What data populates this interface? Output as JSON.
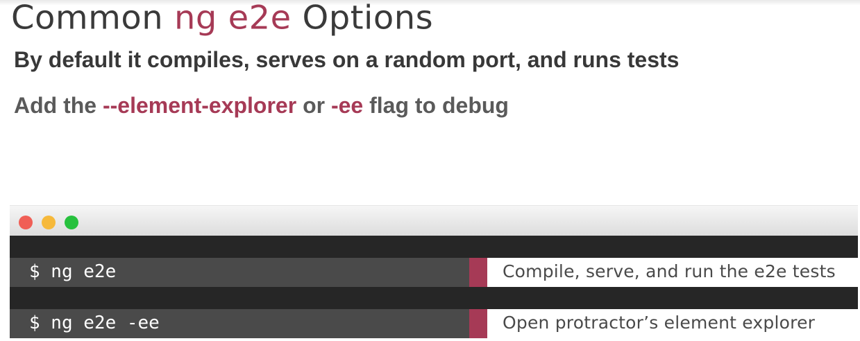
{
  "slide": {
    "title_pre": "Common ",
    "title_accent": "ng e2e",
    "title_post": " Options",
    "line1": "By default it compiles, serves on a random port, and runs tests",
    "line2_pre": "Add the ",
    "line2_flag1": "--element-explorer",
    "line2_mid": " or ",
    "line2_flag2": "-ee",
    "line2_post": " flag to debug"
  },
  "terminal": {
    "rows": [
      {
        "command": "$ ng e2e",
        "description": "Compile, serve, and run the e2e tests"
      },
      {
        "command": "$ ng e2e -ee",
        "description": "Open protractor’s element explorer"
      }
    ]
  },
  "colors": {
    "accent": "#a63a56",
    "terminal_dark": "#262626",
    "terminal_cmd": "#4a4a4a"
  }
}
